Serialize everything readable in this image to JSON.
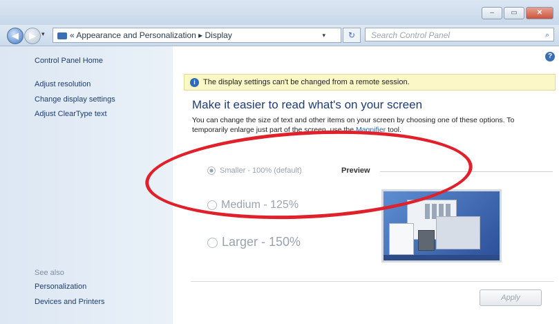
{
  "window": {
    "buttons": {
      "minimize": "–",
      "maximize": "▭",
      "close": "✕"
    }
  },
  "nav": {
    "back_glyph": "◀",
    "forward_glyph": "▶",
    "dropdown_glyph": "▾"
  },
  "address": {
    "breadcrumb": "« Appearance and Personalization ▸ Display",
    "dropdown_glyph": "▾",
    "refresh_glyph": "↻"
  },
  "search": {
    "placeholder": "Search Control Panel",
    "icon_glyph": "⌕"
  },
  "sidebar": {
    "home": "Control Panel Home",
    "links": [
      "Adjust resolution",
      "Change display settings",
      "Adjust ClearType text"
    ],
    "see_also_heading": "See also",
    "see_also": [
      "Personalization",
      "Devices and Printers"
    ]
  },
  "help_glyph": "?",
  "banner": {
    "icon_glyph": "i",
    "text": "The display settings can't be changed from a remote session."
  },
  "main": {
    "heading": "Make it easier to read what's on your screen",
    "description": "You can change the size of text and other items on your screen by choosing one of these options. To temporarily enlarge just part of the screen, use the",
    "magnifier_link": "Magnifier",
    "description_end": "tool."
  },
  "options": {
    "smaller": "Smaller - 100% (default)",
    "medium": "Medium - 125%",
    "larger": "Larger - 150%",
    "selected": "smaller"
  },
  "preview_label": "Preview",
  "apply_label": "Apply",
  "colors": {
    "annotation_ellipse": "#e0202a",
    "heading": "#1e3c73",
    "banner_bg": "#fcf7c6"
  }
}
